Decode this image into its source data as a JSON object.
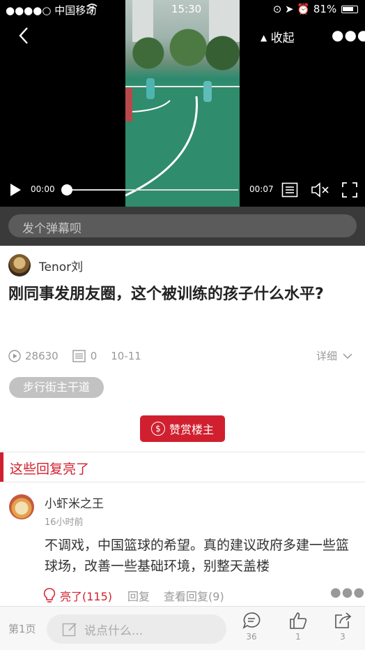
{
  "status_bar": {
    "carrier": "●●●●○ 中国移动",
    "time": "15:30",
    "battery": "81%"
  },
  "video": {
    "collapse_label": "收起",
    "current_time": "00:00",
    "duration": "00:07",
    "progress": 0,
    "danmu_placeholder": "发个弹幕呗"
  },
  "post": {
    "author": "Tenor刘",
    "title": "刚同事发朋友圈，这个被训练的孩子什么水平?",
    "views": "28630",
    "comments": "0",
    "date": "10-11",
    "detail_label": "详细",
    "tag": "步行街主干道",
    "reward_label": "赞赏楼主"
  },
  "highlight_section": {
    "title": "这些回复亮了"
  },
  "reply": {
    "user": "小虾米之王",
    "time": "16小时前",
    "text": "不调戏，中国篮球的希望。真的建议政府多建一些篮球场，改善一些基础环境，别整天盖楼",
    "light_label": "亮了(115)",
    "reply_label": "回复",
    "view_replies_label": "查看回复(9)"
  },
  "bottom_bar": {
    "page_label": "第1页",
    "input_placeholder": "说点什么...",
    "comments_count": "36",
    "likes_count": "1",
    "shares_count": "3"
  },
  "colors": {
    "accent": "#d0202f",
    "video_bg": "#000000",
    "danmu_bar": "#3a3a3a"
  }
}
